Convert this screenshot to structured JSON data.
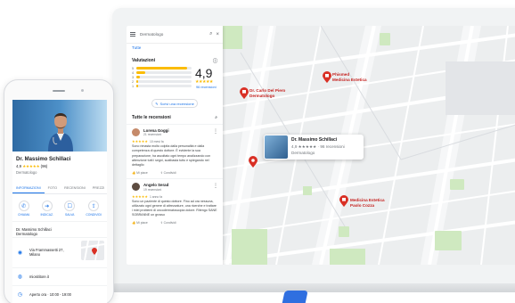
{
  "laptop": {
    "panel": {
      "search_text": "Dermatologo",
      "tab": "Tutte",
      "summary_title": "Valutazioni",
      "bar_labels": [
        "5",
        "4",
        "3",
        "2",
        "1"
      ],
      "bar_levels": [
        0.92,
        0.16,
        0.06,
        0.03,
        0.03
      ],
      "score": "4,9",
      "stars": "★★★★★",
      "review_count": "96 recensioni",
      "write_review": "Scrivi una recensione",
      "all_reviews_title": "Tutte le recensioni",
      "reviews": [
        {
          "name": "Lorena Goggi",
          "sub": "21 recensioni",
          "stars": "★★★★★",
          "time": "10 mesi fa",
          "text": "Sono rimasta molto colpita dalla personalità e dalla competenza di questo dottore. È evidente la sua preparazione, ha ascoltato ogni tempo analizzando con attenzione tutti i segni, scatbasta tutto e spiegando nel dettaglio",
          "likes": "Mi piace",
          "share": "Condividi"
        },
        {
          "name": "Angelo Serad",
          "sub": "19 recensioni",
          "stars": "★★★★★",
          "time": "1 anno fa",
          "text": "Sono un paziente di questo dottore. Fino ad ora nessuna, utilizzato ogni genere di attrezzature, una ricerche e trattare i miei problemi di oncodermatoscopia dolore. Ritengo SANE SOBRANNE un grosso",
          "likes": "Mi piace",
          "share": "Condividi"
        }
      ]
    },
    "map": {
      "labels": {
        "dr_carlo": "Dr. Carlo Del Piero\nDermatologo",
        "phismed": "Phismed\nMedicina Estetica",
        "medicina_estetica": "Medicina Estetica\nPaolo Cozza"
      },
      "card": {
        "name": "Dr. Massimo Schillaci",
        "rating": "4,9 ★★★★★ · 96 recensioni",
        "category": "Dermatologo"
      }
    }
  },
  "phone": {
    "title": "Dr. Massimo Schillaci",
    "rating_value": "4,9",
    "stars": "★★★★★",
    "rating_count": "(96)",
    "category": "Dermatologo",
    "tabs": [
      "INFORMAZIONI",
      "FOTO",
      "RECENSIONI",
      "PREZZI"
    ],
    "actions": [
      {
        "label": "CHIAMA",
        "icon": "phone-icon",
        "glyph": "✆"
      },
      {
        "label": "INDICAZ.",
        "icon": "directions-icon",
        "glyph": "➔"
      },
      {
        "label": "SALVA",
        "icon": "bookmark-icon",
        "glyph": "☐"
      },
      {
        "label": "CONDIVIDI",
        "icon": "share-icon",
        "glyph": "⇪"
      }
    ],
    "name_block": "Dr. Massimo Schillaci\nDermatologo",
    "address": "Via Frammassetti 27,\nMilano",
    "website": "miosititore.it",
    "hours": "Aperto ora · 10:00 - 19:00"
  },
  "colors": {
    "accent": "#1a73e8",
    "star": "#fbbc04",
    "pin": "#d93025"
  }
}
